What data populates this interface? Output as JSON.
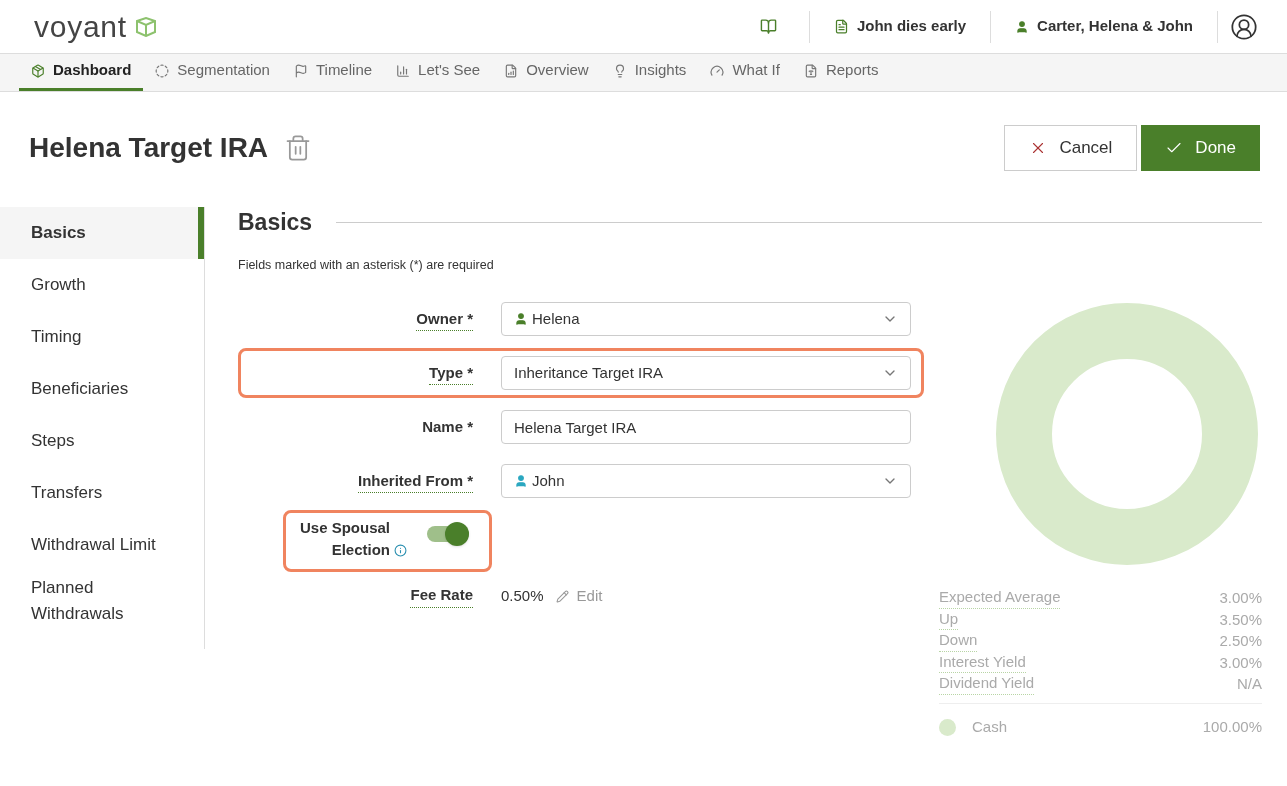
{
  "header": {
    "logo": "voyant",
    "scenario": "John dies early",
    "household": "Carter, Helena & John"
  },
  "nav": [
    {
      "label": "Dashboard",
      "selected": true
    },
    {
      "label": "Segmentation",
      "selected": false
    },
    {
      "label": "Timeline",
      "selected": false
    },
    {
      "label": "Let's See",
      "selected": false
    },
    {
      "label": "Overview",
      "selected": false
    },
    {
      "label": "Insights",
      "selected": false
    },
    {
      "label": "What If",
      "selected": false
    },
    {
      "label": "Reports",
      "selected": false
    }
  ],
  "page": {
    "title": "Helena Target IRA",
    "buttons": {
      "cancel": "Cancel",
      "done": "Done"
    }
  },
  "sidebar": [
    {
      "label": "Basics",
      "selected": true
    },
    {
      "label": "Growth",
      "selected": false
    },
    {
      "label": "Timing",
      "selected": false
    },
    {
      "label": "Beneficiaries",
      "selected": false
    },
    {
      "label": "Steps",
      "selected": false
    },
    {
      "label": "Transfers",
      "selected": false
    },
    {
      "label": "Withdrawal Limit",
      "selected": false
    },
    {
      "label": "Planned Withdrawals",
      "selected": false
    }
  ],
  "section": {
    "title": "Basics",
    "note": "Fields marked with an asterisk (*) are required"
  },
  "fields": [
    {
      "kind": "select",
      "label": "Owner *",
      "value": "Helena",
      "color": "#4a7f2a",
      "highlighted": false
    },
    {
      "kind": "select",
      "label": "Type *",
      "value": "Inheritance Target IRA",
      "highlighted": true
    },
    {
      "kind": "text",
      "label": "Name *",
      "value": "Helena Target IRA",
      "highlighted": false
    },
    {
      "kind": "select",
      "label": "Inherited From *",
      "value": "John",
      "color": "#2aa7c0",
      "highlighted": false
    },
    {
      "kind": "toggle",
      "label": "Use Spousal Election",
      "on": true,
      "info": true,
      "highlighted": true
    },
    {
      "kind": "readonly",
      "label": "Fee Rate",
      "value": "0.50%",
      "action": "Edit",
      "highlighted": false
    }
  ],
  "stats": [
    {
      "label": "Expected Average",
      "value": "3.00%"
    },
    {
      "label": "Up",
      "value": "3.50%"
    },
    {
      "label": "Down",
      "value": "2.50%"
    },
    {
      "label": "Interest Yield",
      "value": "3.00%"
    },
    {
      "label": "Dividend Yield",
      "value": "N/A"
    }
  ],
  "legend": [
    {
      "label": "Cash",
      "value": "100.00%",
      "color": "#d9eacb"
    }
  ]
}
